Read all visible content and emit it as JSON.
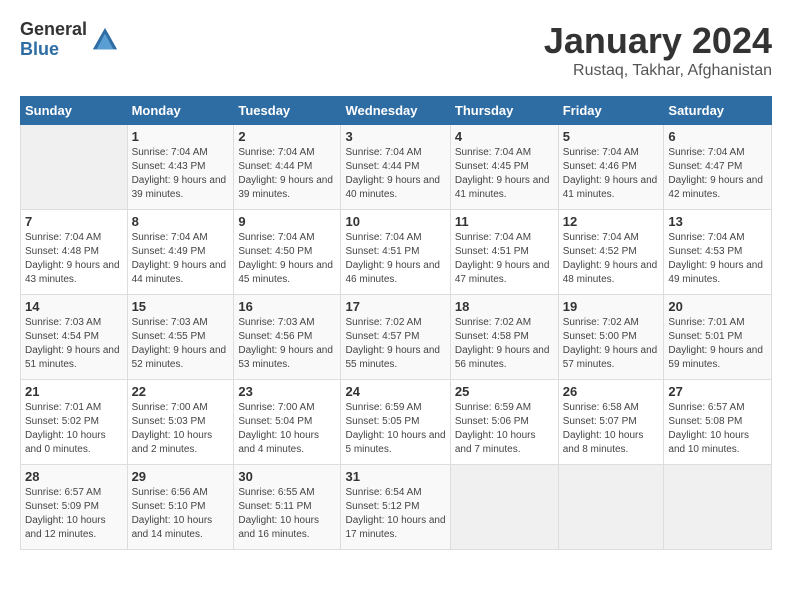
{
  "logo": {
    "general": "General",
    "blue": "Blue"
  },
  "title": "January 2024",
  "subtitle": "Rustaq, Takhar, Afghanistan",
  "headers": [
    "Sunday",
    "Monday",
    "Tuesday",
    "Wednesday",
    "Thursday",
    "Friday",
    "Saturday"
  ],
  "weeks": [
    [
      {
        "day": "",
        "sunrise": "",
        "sunset": "",
        "daylight": ""
      },
      {
        "day": "1",
        "sunrise": "Sunrise: 7:04 AM",
        "sunset": "Sunset: 4:43 PM",
        "daylight": "Daylight: 9 hours and 39 minutes."
      },
      {
        "day": "2",
        "sunrise": "Sunrise: 7:04 AM",
        "sunset": "Sunset: 4:44 PM",
        "daylight": "Daylight: 9 hours and 39 minutes."
      },
      {
        "day": "3",
        "sunrise": "Sunrise: 7:04 AM",
        "sunset": "Sunset: 4:44 PM",
        "daylight": "Daylight: 9 hours and 40 minutes."
      },
      {
        "day": "4",
        "sunrise": "Sunrise: 7:04 AM",
        "sunset": "Sunset: 4:45 PM",
        "daylight": "Daylight: 9 hours and 41 minutes."
      },
      {
        "day": "5",
        "sunrise": "Sunrise: 7:04 AM",
        "sunset": "Sunset: 4:46 PM",
        "daylight": "Daylight: 9 hours and 41 minutes."
      },
      {
        "day": "6",
        "sunrise": "Sunrise: 7:04 AM",
        "sunset": "Sunset: 4:47 PM",
        "daylight": "Daylight: 9 hours and 42 minutes."
      }
    ],
    [
      {
        "day": "7",
        "sunrise": "Sunrise: 7:04 AM",
        "sunset": "Sunset: 4:48 PM",
        "daylight": "Daylight: 9 hours and 43 minutes."
      },
      {
        "day": "8",
        "sunrise": "Sunrise: 7:04 AM",
        "sunset": "Sunset: 4:49 PM",
        "daylight": "Daylight: 9 hours and 44 minutes."
      },
      {
        "day": "9",
        "sunrise": "Sunrise: 7:04 AM",
        "sunset": "Sunset: 4:50 PM",
        "daylight": "Daylight: 9 hours and 45 minutes."
      },
      {
        "day": "10",
        "sunrise": "Sunrise: 7:04 AM",
        "sunset": "Sunset: 4:51 PM",
        "daylight": "Daylight: 9 hours and 46 minutes."
      },
      {
        "day": "11",
        "sunrise": "Sunrise: 7:04 AM",
        "sunset": "Sunset: 4:51 PM",
        "daylight": "Daylight: 9 hours and 47 minutes."
      },
      {
        "day": "12",
        "sunrise": "Sunrise: 7:04 AM",
        "sunset": "Sunset: 4:52 PM",
        "daylight": "Daylight: 9 hours and 48 minutes."
      },
      {
        "day": "13",
        "sunrise": "Sunrise: 7:04 AM",
        "sunset": "Sunset: 4:53 PM",
        "daylight": "Daylight: 9 hours and 49 minutes."
      }
    ],
    [
      {
        "day": "14",
        "sunrise": "Sunrise: 7:03 AM",
        "sunset": "Sunset: 4:54 PM",
        "daylight": "Daylight: 9 hours and 51 minutes."
      },
      {
        "day": "15",
        "sunrise": "Sunrise: 7:03 AM",
        "sunset": "Sunset: 4:55 PM",
        "daylight": "Daylight: 9 hours and 52 minutes."
      },
      {
        "day": "16",
        "sunrise": "Sunrise: 7:03 AM",
        "sunset": "Sunset: 4:56 PM",
        "daylight": "Daylight: 9 hours and 53 minutes."
      },
      {
        "day": "17",
        "sunrise": "Sunrise: 7:02 AM",
        "sunset": "Sunset: 4:57 PM",
        "daylight": "Daylight: 9 hours and 55 minutes."
      },
      {
        "day": "18",
        "sunrise": "Sunrise: 7:02 AM",
        "sunset": "Sunset: 4:58 PM",
        "daylight": "Daylight: 9 hours and 56 minutes."
      },
      {
        "day": "19",
        "sunrise": "Sunrise: 7:02 AM",
        "sunset": "Sunset: 5:00 PM",
        "daylight": "Daylight: 9 hours and 57 minutes."
      },
      {
        "day": "20",
        "sunrise": "Sunrise: 7:01 AM",
        "sunset": "Sunset: 5:01 PM",
        "daylight": "Daylight: 9 hours and 59 minutes."
      }
    ],
    [
      {
        "day": "21",
        "sunrise": "Sunrise: 7:01 AM",
        "sunset": "Sunset: 5:02 PM",
        "daylight": "Daylight: 10 hours and 0 minutes."
      },
      {
        "day": "22",
        "sunrise": "Sunrise: 7:00 AM",
        "sunset": "Sunset: 5:03 PM",
        "daylight": "Daylight: 10 hours and 2 minutes."
      },
      {
        "day": "23",
        "sunrise": "Sunrise: 7:00 AM",
        "sunset": "Sunset: 5:04 PM",
        "daylight": "Daylight: 10 hours and 4 minutes."
      },
      {
        "day": "24",
        "sunrise": "Sunrise: 6:59 AM",
        "sunset": "Sunset: 5:05 PM",
        "daylight": "Daylight: 10 hours and 5 minutes."
      },
      {
        "day": "25",
        "sunrise": "Sunrise: 6:59 AM",
        "sunset": "Sunset: 5:06 PM",
        "daylight": "Daylight: 10 hours and 7 minutes."
      },
      {
        "day": "26",
        "sunrise": "Sunrise: 6:58 AM",
        "sunset": "Sunset: 5:07 PM",
        "daylight": "Daylight: 10 hours and 8 minutes."
      },
      {
        "day": "27",
        "sunrise": "Sunrise: 6:57 AM",
        "sunset": "Sunset: 5:08 PM",
        "daylight": "Daylight: 10 hours and 10 minutes."
      }
    ],
    [
      {
        "day": "28",
        "sunrise": "Sunrise: 6:57 AM",
        "sunset": "Sunset: 5:09 PM",
        "daylight": "Daylight: 10 hours and 12 minutes."
      },
      {
        "day": "29",
        "sunrise": "Sunrise: 6:56 AM",
        "sunset": "Sunset: 5:10 PM",
        "daylight": "Daylight: 10 hours and 14 minutes."
      },
      {
        "day": "30",
        "sunrise": "Sunrise: 6:55 AM",
        "sunset": "Sunset: 5:11 PM",
        "daylight": "Daylight: 10 hours and 16 minutes."
      },
      {
        "day": "31",
        "sunrise": "Sunrise: 6:54 AM",
        "sunset": "Sunset: 5:12 PM",
        "daylight": "Daylight: 10 hours and 17 minutes."
      },
      {
        "day": "",
        "sunrise": "",
        "sunset": "",
        "daylight": ""
      },
      {
        "day": "",
        "sunrise": "",
        "sunset": "",
        "daylight": ""
      },
      {
        "day": "",
        "sunrise": "",
        "sunset": "",
        "daylight": ""
      }
    ]
  ]
}
